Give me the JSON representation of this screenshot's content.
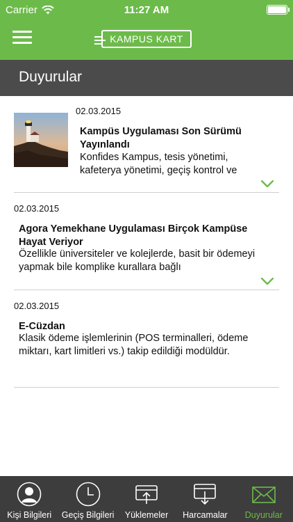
{
  "status": {
    "carrier": "Carrier",
    "time": "11:27 AM"
  },
  "nav": {
    "menu_icon": "hamburger-icon",
    "logo_text": "KAMPUS KART"
  },
  "page": {
    "title": "Duyurular"
  },
  "announcements": [
    {
      "date": "02.03.2015",
      "headline": "Kampüs Uygulaması Son Sürümü Yayınlandı",
      "body": "Konfides Kampus, tesis yönetimi, kafeterya yönetimi, geçiş kontrol ve",
      "has_image": true,
      "expandable": true
    },
    {
      "date": "02.03.2015",
      "headline": "Agora Yemekhane Uygulaması Birçok Kampüse Hayat Veriyor",
      "body": "Özellikle üniversiteler ve kolejlerde, basit bir ödemeyi yapmak bile komplike kurallara bağlı",
      "has_image": false,
      "expandable": true
    },
    {
      "date": "02.03.2015",
      "headline": "E-Cüzdan",
      "body": "Klasik ödeme işlemlerinin (POS terminalleri, ödeme miktarı, kart limitleri vs.) takip edildiği modüldür.",
      "has_image": false,
      "expandable": false
    }
  ],
  "tabs": [
    {
      "label": "Kişi Bilgileri",
      "icon": "person-icon",
      "active": false
    },
    {
      "label": "Geçiş Bilgileri",
      "icon": "clock-icon",
      "active": false
    },
    {
      "label": "Yüklemeler",
      "icon": "upload-card-icon",
      "active": false
    },
    {
      "label": "Harcamalar",
      "icon": "download-card-icon",
      "active": false
    },
    {
      "label": "Duyurular",
      "icon": "envelope-icon",
      "active": true
    }
  ],
  "colors": {
    "accent": "#6cbb4a",
    "titlebar": "#4b4b4b",
    "tabbar": "#3d3d3d"
  }
}
